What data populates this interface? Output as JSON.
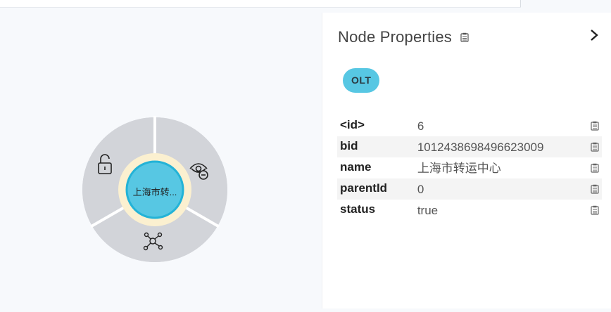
{
  "panel": {
    "title": "Node Properties",
    "label": "OLT",
    "properties": [
      {
        "key": "<id>",
        "value": "6"
      },
      {
        "key": "bid",
        "value": "1012438698496623009"
      },
      {
        "key": "name",
        "value": "上海市转运中心"
      },
      {
        "key": "parentId",
        "value": "0"
      },
      {
        "key": "status",
        "value": "true"
      }
    ]
  },
  "node": {
    "caption": "上海市转...",
    "ring_menu": [
      "unlock-icon",
      "hide-icon",
      "expand-icon"
    ]
  },
  "colors": {
    "node_fill": "#57c7e3",
    "node_border": "#23b3d7",
    "halo": "#fbf0d0",
    "ring": "#d2d4d9",
    "badge": "#57c7e3"
  }
}
